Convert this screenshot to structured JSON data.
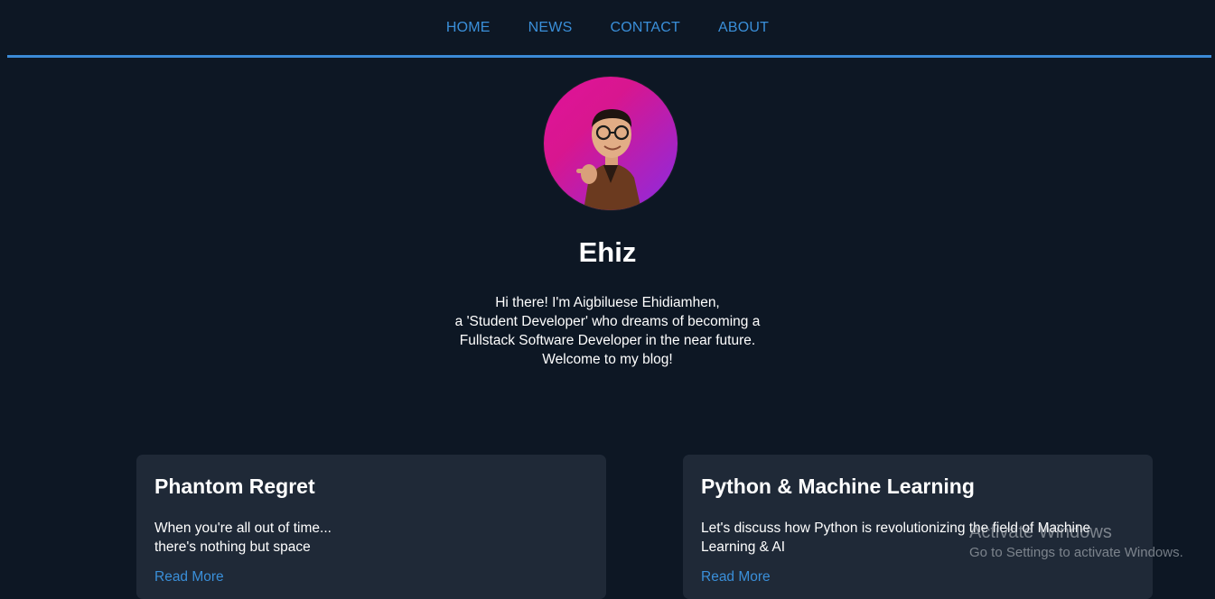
{
  "nav": {
    "items": [
      {
        "label": "HOME"
      },
      {
        "label": "NEWS"
      },
      {
        "label": "CONTACT"
      },
      {
        "label": "ABOUT"
      }
    ]
  },
  "profile": {
    "name": "Ehiz",
    "bio_lines": [
      "Hi there! I'm Aigbiluese Ehidiamhen,",
      "a 'Student Developer' who dreams of becoming a",
      "Fullstack Software Developer in the near future.",
      "Welcome to my blog!"
    ]
  },
  "posts": [
    {
      "title": "Phantom Regret",
      "excerpt_lines": [
        "When you're all out of time...",
        "there's nothing but space"
      ],
      "link": "Read More"
    },
    {
      "title": "Python & Machine Learning",
      "excerpt_lines": [
        "Let's discuss how Python is revolutionizing the field of Machine",
        "Learning & AI"
      ],
      "link": "Read More"
    }
  ],
  "watermark": {
    "line1": "Activate Windows",
    "line2": "Go to Settings to activate Windows."
  },
  "colors": {
    "background": "#0d1724",
    "accent": "#3a8fd9",
    "card": "#1f2937"
  }
}
